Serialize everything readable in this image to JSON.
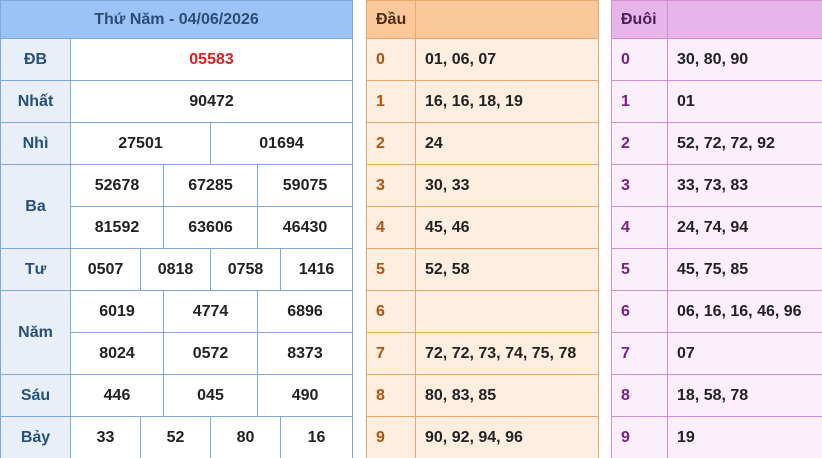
{
  "results": {
    "title": "Thứ Năm - 04/06/2026",
    "rows": {
      "db": {
        "label": "ĐB",
        "values": [
          "05583"
        ]
      },
      "nhat": {
        "label": "Nhất",
        "values": [
          "90472"
        ]
      },
      "nhi": {
        "label": "Nhì",
        "values": [
          "27501",
          "01694"
        ]
      },
      "ba": {
        "label": "Ba",
        "values": [
          "52678",
          "67285",
          "59075",
          "81592",
          "63606",
          "46430"
        ]
      },
      "tu": {
        "label": "Tư",
        "values": [
          "0507",
          "0818",
          "0758",
          "1416"
        ]
      },
      "nam": {
        "label": "Năm",
        "values": [
          "6019",
          "4774",
          "6896",
          "8024",
          "0572",
          "8373"
        ]
      },
      "sau": {
        "label": "Sáu",
        "values": [
          "446",
          "045",
          "490"
        ]
      },
      "bay": {
        "label": "Bảy",
        "values": [
          "33",
          "52",
          "80",
          "16"
        ]
      }
    }
  },
  "dau": {
    "header": "Đầu",
    "rows": [
      {
        "digit": "0",
        "values": "01, 06, 07"
      },
      {
        "digit": "1",
        "values": "16, 16, 18, 19"
      },
      {
        "digit": "2",
        "values": "24"
      },
      {
        "digit": "3",
        "values": "30, 33"
      },
      {
        "digit": "4",
        "values": "45, 46"
      },
      {
        "digit": "5",
        "values": "52, 58"
      },
      {
        "digit": "6",
        "values": ""
      },
      {
        "digit": "7",
        "values": "72, 72, 73, 74, 75, 78"
      },
      {
        "digit": "8",
        "values": "80, 83, 85"
      },
      {
        "digit": "9",
        "values": "90, 92, 94, 96"
      }
    ]
  },
  "duoi": {
    "header": "Đuôi",
    "rows": [
      {
        "digit": "0",
        "values": "30, 80, 90"
      },
      {
        "digit": "1",
        "values": "01"
      },
      {
        "digit": "2",
        "values": "52, 72, 72, 92"
      },
      {
        "digit": "3",
        "values": "33, 73, 83"
      },
      {
        "digit": "4",
        "values": "24, 74, 94"
      },
      {
        "digit": "5",
        "values": "45, 75, 85"
      },
      {
        "digit": "6",
        "values": "06, 16, 16, 46, 96"
      },
      {
        "digit": "7",
        "values": "07"
      },
      {
        "digit": "8",
        "values": "18, 58, 78"
      },
      {
        "digit": "9",
        "values": "19"
      }
    ]
  },
  "colors": {
    "special_prize": "#e01c1c",
    "results_header": "#9cc3f6",
    "dau_header": "#fbc89b",
    "duoi_header": "#e7b4ea"
  }
}
